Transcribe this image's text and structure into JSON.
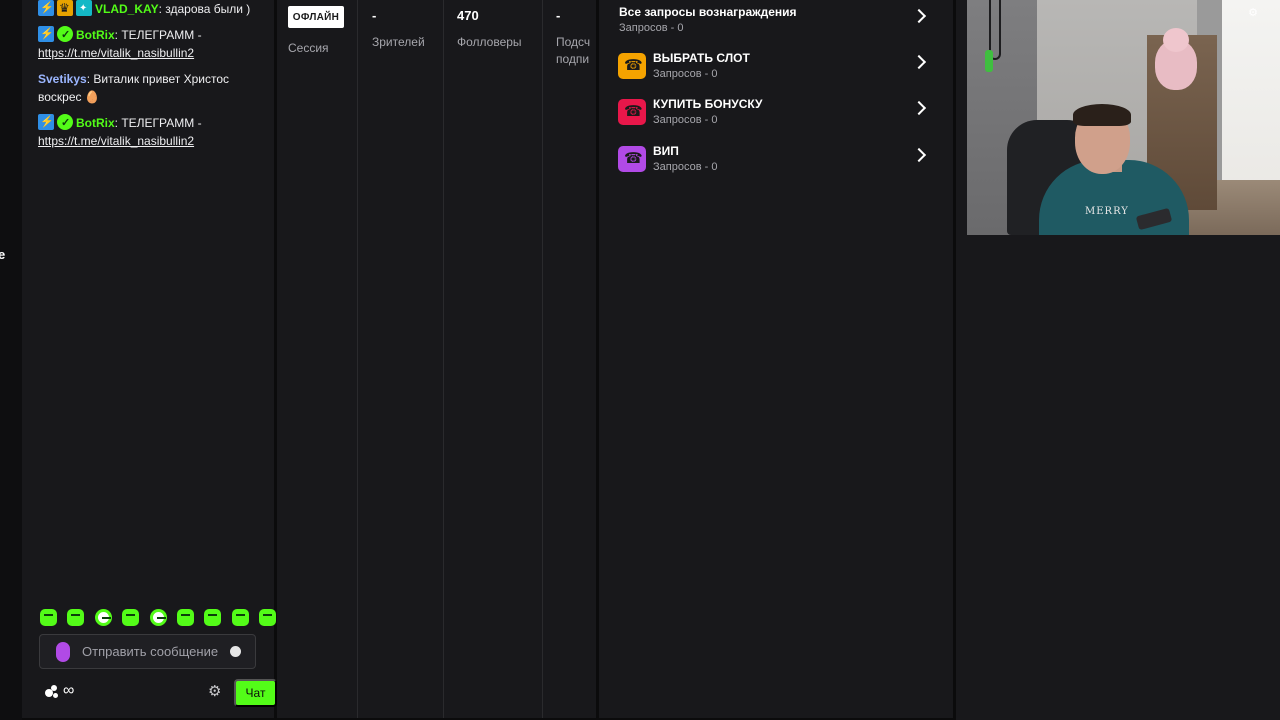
{
  "left_fragment": "е",
  "chat": {
    "messages": [
      {
        "badges": [
          "kick",
          "crown",
          "sub"
        ],
        "user": "VLAD_KAY",
        "user_color": "#53fc18",
        "text": ": здарова были )"
      },
      {
        "badges": [
          "kick",
          "verified"
        ],
        "user": "BotRix",
        "user_color": "#53fc18",
        "text": ": ТЕЛЕГРАММ -",
        "link": "https://t.me/vitalik_nasibullin2"
      },
      {
        "badges": [],
        "user": "Svetikys",
        "user_color": "#9bb6ff",
        "text": ": Виталик привет Христос воскрес 🥚"
      },
      {
        "badges": [
          "kick",
          "verified"
        ],
        "user": "BotRix",
        "user_color": "#53fc18",
        "text": ": ТЕЛЕГРАММ -",
        "link": "https://t.me/vitalik_nasibullin2"
      }
    ],
    "emote_count": 9,
    "input_placeholder": "Отправить сообщение",
    "infinity_symbol": "∞",
    "send_label": "Чат"
  },
  "stats": {
    "offline_badge": "ОФЛАЙН",
    "session_label": "Сессия",
    "viewers_value": "-",
    "viewers_label": "Зрителей",
    "followers_value": "470",
    "followers_label": "Фолловеры",
    "subs_value": "-",
    "subs_label_line1": "Подсч",
    "subs_label_line2": "подпи"
  },
  "rewards": {
    "all_title": "Все запросы вознаграждения",
    "all_sub": "Запросов - 0",
    "items": [
      {
        "title": "ВЫБРАТЬ СЛОТ",
        "sub": "Запросов - 0",
        "color": "#f5a300"
      },
      {
        "title": "КУПИТЬ БОНУСКУ",
        "sub": "Запросов - 0",
        "color": "#e8174a"
      },
      {
        "title": "ВИП",
        "sub": "Запросов - 0",
        "color": "#b14ae6"
      }
    ]
  },
  "webcam": {
    "shirt_text": "MERRY"
  },
  "colors": {
    "accent_green": "#53fc18",
    "panel_bg": "#18181b",
    "page_bg": "#0b0b0c"
  }
}
